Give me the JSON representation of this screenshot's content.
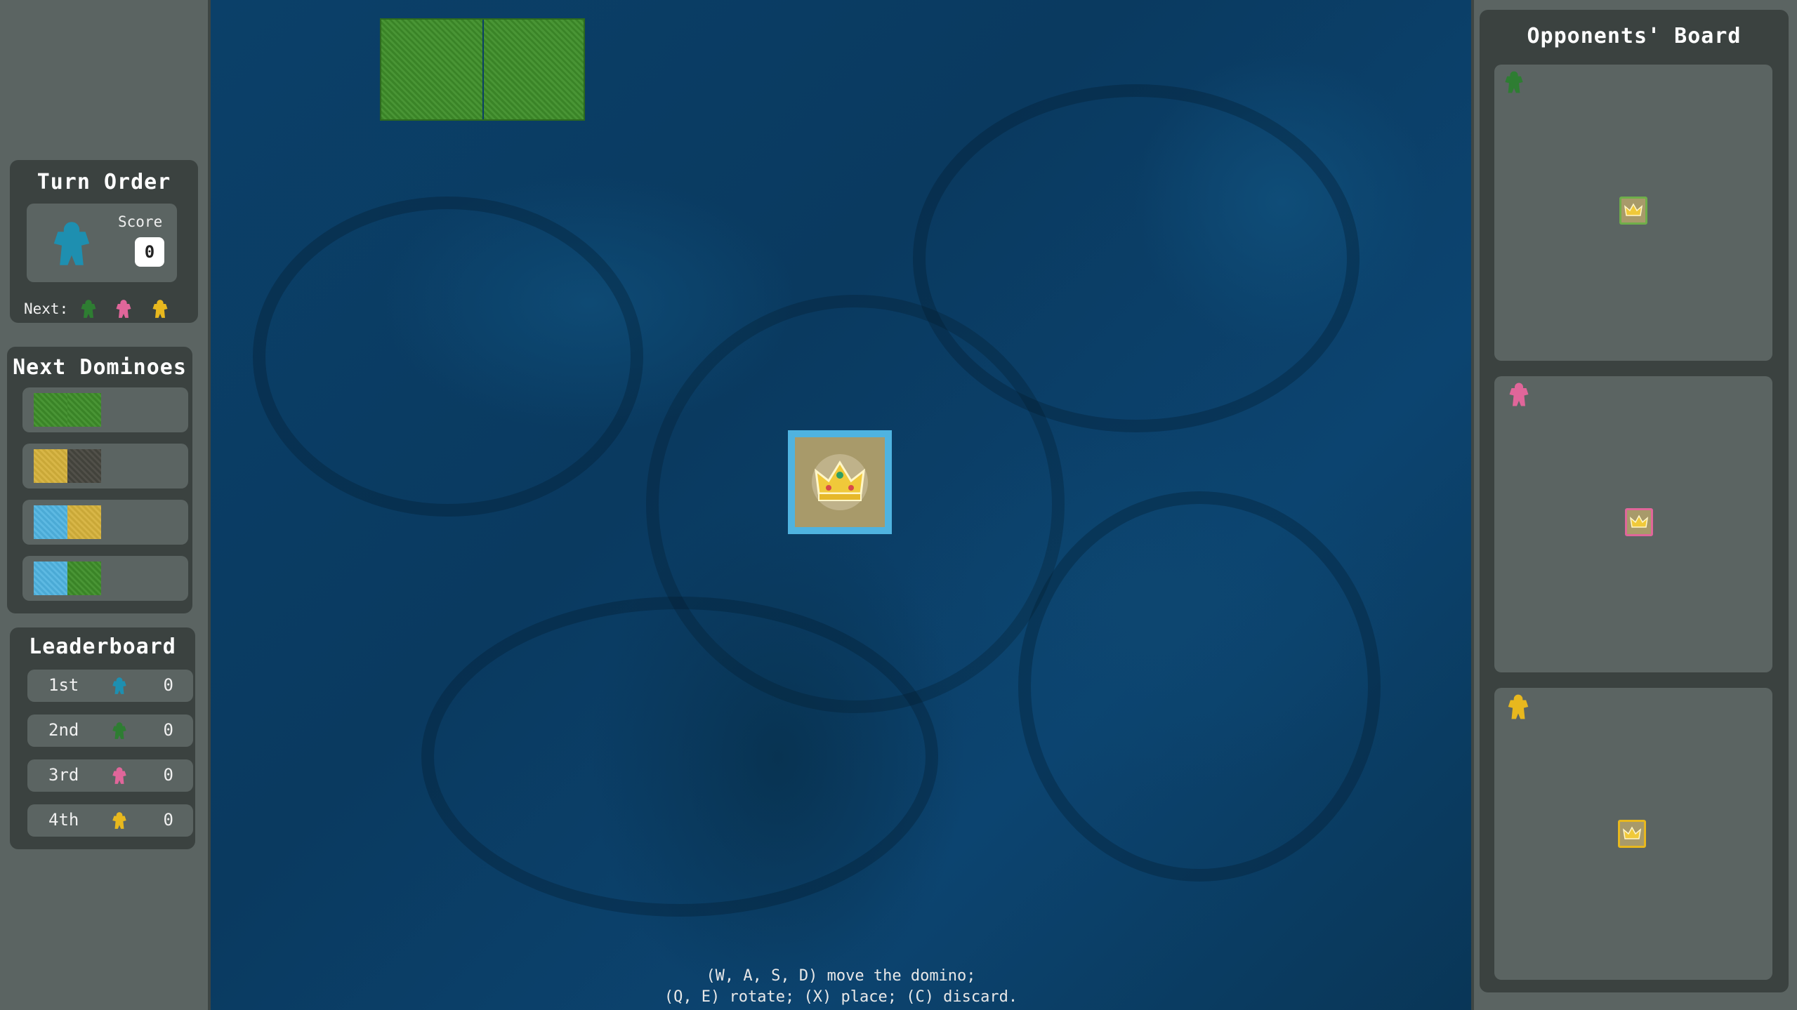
{
  "turn_order": {
    "title": "Turn Order",
    "score_label": "Score",
    "score_value": "0",
    "next_label": "Next:",
    "current_player_color": "#1e8fb0",
    "next_player_colors": [
      "#2e7d32",
      "#e0669a",
      "#e8b81e"
    ]
  },
  "next_dominoes": {
    "title": "Next Dominoes",
    "items": [
      {
        "left": "grass",
        "right": "grass"
      },
      {
        "left": "wheat",
        "right": "swamp"
      },
      {
        "left": "water",
        "right": "wheat"
      },
      {
        "left": "water",
        "right": "grass"
      }
    ]
  },
  "leaderboard": {
    "title": "Leaderboard",
    "rows": [
      {
        "rank": "1st",
        "color": "#1e8fb0",
        "score": "0"
      },
      {
        "rank": "2nd",
        "color": "#2e7d32",
        "score": "0"
      },
      {
        "rank": "3rd",
        "color": "#e0669a",
        "score": "0"
      },
      {
        "rank": "4th",
        "color": "#e8b81e",
        "score": "0"
      }
    ]
  },
  "opponents": {
    "title": "Opponents' Board",
    "boards": [
      {
        "player_color": "#2e7d32",
        "castle_border": "#6fae4a"
      },
      {
        "player_color": "#e0669a",
        "castle_border": "#e0669a"
      },
      {
        "player_color": "#e8b81e",
        "castle_border": "#e8b81e"
      }
    ]
  },
  "main_board": {
    "castle_icon": "crown-icon",
    "castle_border_color": "#4fb3e0",
    "held_domino": {
      "left": "grass",
      "right": "grass"
    }
  },
  "controls": {
    "line1": "(W, A, S, D) move the domino;",
    "line2": "(Q, E) rotate; (X) place; (C) discard."
  }
}
